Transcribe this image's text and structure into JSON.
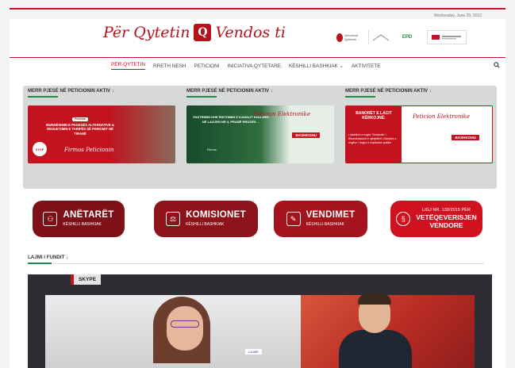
{
  "date": "Wednesday, June 29, 2022",
  "brand": {
    "left": "Për Qytetin",
    "badge": "Q",
    "right": "Vendos ti",
    "accent": "#b5121b"
  },
  "partners": [
    {
      "label": "Qendresa Qytetare"
    },
    {
      "label": ""
    },
    {
      "label": "EPD"
    },
    {
      "label": ""
    }
  ],
  "nav": {
    "items": [
      {
        "label": "PER-QYTETIN",
        "active": true
      },
      {
        "label": "RRETH NESH"
      },
      {
        "label": "PETICIONI"
      },
      {
        "label": "INICIATIVA QYTETARE"
      },
      {
        "label": "KËSHILLI BASHKIAK ⌄"
      },
      {
        "label": "AKTIVITETE"
      }
    ],
    "search_icon": "search-icon"
  },
  "petitions": {
    "heading": "MERR PJESË NË PETICIONIN AKTIV ↓",
    "banner1": {
      "tag": "Peticion",
      "text": "MUNDËSIMIN E PAGESËS ALTERNATIVE & REDUKTIMIN E TARIFËS SË PARKIMIT NË TIRANË",
      "stop": "STOP",
      "script": "Firmos Peticionin"
    },
    "banner2": {
      "text": "PASTRIMIN DHE RIKTHIMIN E KANALIT KULLUES NË LAGJEN NR 4, PRANË RRUGËS ...",
      "script": "Peticion Elektronike",
      "tag": "BASHKOHU",
      "pin": "Firmos"
    },
    "banner3": {
      "title": "BANORËT E LACIT KËRKOJNË:",
      "list": "• Asfaltimin e rrugës \"Xhelaludin\" • Rikonstruksionin e ujësjellësit • Ndriçimin e rrugëve • Hapjen e hapësirave publike",
      "script": "Peticion Elektronike",
      "tag": "BASHKOHU"
    }
  },
  "quick_links": [
    {
      "main": "ANËTARËT",
      "sub": "KËSHILLI BASHKIAK",
      "icon": "members-icon",
      "glyph": "⚇"
    },
    {
      "main": "KOMISIONET",
      "sub": "KËSHILLI BASHKIAK",
      "icon": "committees-icon",
      "glyph": "⚖"
    },
    {
      "main": "VENDIMET",
      "sub": "KËSHILLI BASHKIAK",
      "icon": "decisions-icon",
      "glyph": "✎"
    },
    {
      "law_top": "LIGJ NR. 139/2015 PËR",
      "law_main": "VETËQEVERISJEN",
      "law_bottom": "VENDORE",
      "icon": "law-icon",
      "glyph": "§"
    }
  ],
  "news": {
    "heading": "LAJMI I FUNDIT ↓",
    "video_tag": "SKYPE",
    "lower_third": "LAJME"
  }
}
